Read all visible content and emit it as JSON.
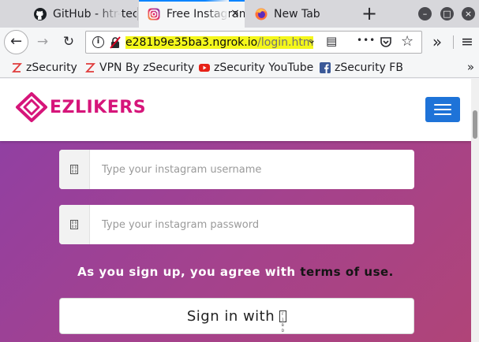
{
  "tabs": [
    {
      "title": "GitHub - htr-tech",
      "icon": "github-icon",
      "active": false
    },
    {
      "title": "Free Instagram",
      "icon": "instagram-icon",
      "active": true
    },
    {
      "title": "New Tab",
      "icon": "firefox-icon",
      "active": false
    }
  ],
  "tab_close_glyph": "×",
  "new_tab_glyph": "+",
  "window_controls": {
    "minimize": "–",
    "maximize": "□",
    "close": "×"
  },
  "nav": {
    "back": "←",
    "forward": "→",
    "reload": "↻"
  },
  "urlbar": {
    "host": "e281b9e35ba3.ngrok.io",
    "path": "/login.htm",
    "info_glyph": "i",
    "highlight_color": "#f4f71b"
  },
  "toolbar": {
    "reader": "▤",
    "more": "•••",
    "pocket": "◡",
    "bookmark_star": "☆",
    "overflow": "»",
    "menu": "≡"
  },
  "bookmarks": [
    {
      "label": "zSecurity",
      "icon": "zsecurity-icon"
    },
    {
      "label": "VPN By zSecurity",
      "icon": "zsecurity-icon"
    },
    {
      "label": "zSecurity YouTube",
      "icon": "youtube-icon"
    },
    {
      "label": "zSecurity FB",
      "icon": "facebook-icon"
    }
  ],
  "bookmarks_more": "»",
  "site": {
    "logo_text": "EZLIKERS",
    "brand_color": "#d6157a",
    "menu_button_color": "#1e73d8",
    "username_placeholder": "Type your instagram username",
    "password_placeholder": "Type your instagram password",
    "addon_glyph": "0 0 0 0",
    "terms_prefix": "As you sign up, you agree with",
    "terms_link": "terms of use.",
    "signin_label": "Sign in with",
    "signin_glyph": "F 1 B D"
  }
}
